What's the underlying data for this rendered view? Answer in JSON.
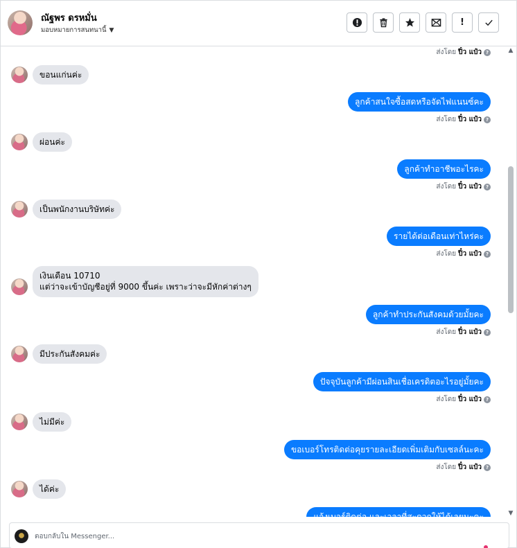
{
  "header": {
    "name": "ณัฐพร ดรหมั่น",
    "assign_label": "มอบหมายการสนทนานี้",
    "tools": [
      {
        "icon": "alert-circle-icon",
        "label": "spam"
      },
      {
        "icon": "trash-icon",
        "label": "delete"
      },
      {
        "icon": "star-icon",
        "label": "follow-up"
      },
      {
        "icon": "mail-icon",
        "label": "mark-unread"
      },
      {
        "icon": "exclamation-icon",
        "label": "flag"
      },
      {
        "icon": "check-icon",
        "label": "done"
      }
    ]
  },
  "sent_by": {
    "prefix": "ส่งโดย",
    "agent": "ปิ๋ว แป๋ว",
    "help": "?"
  },
  "messages": [
    {
      "dir": "in",
      "text": "ขอนแก่นค่ะ"
    },
    {
      "dir": "out",
      "text": "ลูกค้าสนใจซื้อสดหรือจัดไฟแนนซ์คะ"
    },
    {
      "dir": "in",
      "text": "ผ่อนค่ะ"
    },
    {
      "dir": "out",
      "text": "ลูกค้าทำอาชีพอะไรคะ"
    },
    {
      "dir": "in",
      "text": "เป็นพนักงานบริษัทค่ะ"
    },
    {
      "dir": "out",
      "text": "รายได้ต่อเดือนเท่าไหร่คะ"
    },
    {
      "dir": "in",
      "line1": "เงินเดือน 10710",
      "line2": "แต่ว่าจะเข้าบัญชีอยู่ที่ 9000 ขึ้นค่ะ เพราะว่าจะมีหักค่าต่างๆ"
    },
    {
      "dir": "out",
      "text": "ลูกค้าทำประกันสังคมด้วยมั้ยคะ"
    },
    {
      "dir": "in",
      "text": "มีประกันสังคมค่ะ"
    },
    {
      "dir": "out",
      "text": "ปัจจุบันลูกค้ามีผ่อนสินเชื่อเครดิตอะไรอยู่มั้ยคะ"
    },
    {
      "dir": "in",
      "text": "ไม่มีค่ะ"
    },
    {
      "dir": "out",
      "text": "ขอเบอร์โทรติดต่อคุยรายละเอียดเพิ่มเติมกับเซลล์นะคะ"
    },
    {
      "dir": "in",
      "text": "ได้ค่ะ"
    },
    {
      "dir": "out",
      "text": "แจ้งเบอร์ติดต่อ และเวลาที่สะดวกให้ได้เลยนะคะ"
    }
  ],
  "composer": {
    "placeholder": "ตอบกลับใน Messenger..."
  }
}
